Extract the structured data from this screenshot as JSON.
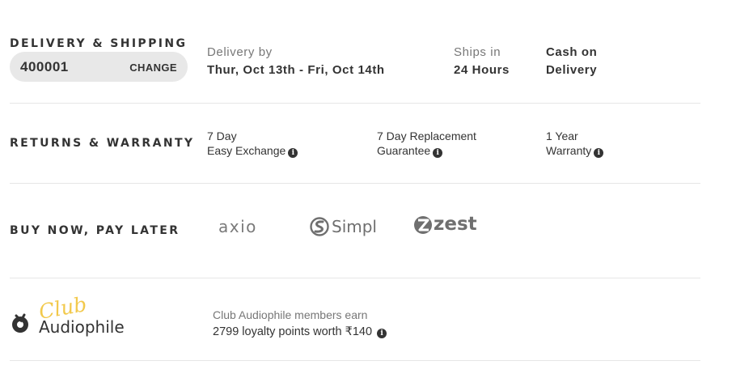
{
  "delivery": {
    "title": "DELIVERY & SHIPPING",
    "pincode": "400001",
    "change_label": "CHANGE",
    "delivery_by_label": "Delivery by",
    "delivery_dates": "Thur, Oct 13th - Fri, Oct 14th",
    "ships_in_label": "Ships in",
    "ships_in_value": "24 Hours",
    "cod_line1": "Cash on",
    "cod_line2": "Delivery"
  },
  "returns": {
    "title": "RETURNS & WARRANTY",
    "items": [
      {
        "line1": "7 Day",
        "line2": "Easy Exchange",
        "icon": "info-icon"
      },
      {
        "line1": "7 Day Replacement",
        "line2": "Guarantee",
        "icon": "info-icon"
      },
      {
        "line1": "1 Year",
        "line2": "Warranty",
        "icon": "info-icon"
      }
    ]
  },
  "bnpl": {
    "title": "BUY NOW, PAY LATER",
    "providers": [
      "axio",
      "Simpl",
      "zest"
    ]
  },
  "club": {
    "logo_script": "Club",
    "logo_word": "Audiophile",
    "line1": "Club Audiophile members earn",
    "line2": "2799 loyalty points worth ₹140",
    "icon": "info-icon",
    "accent_color": "#f2c94c"
  }
}
